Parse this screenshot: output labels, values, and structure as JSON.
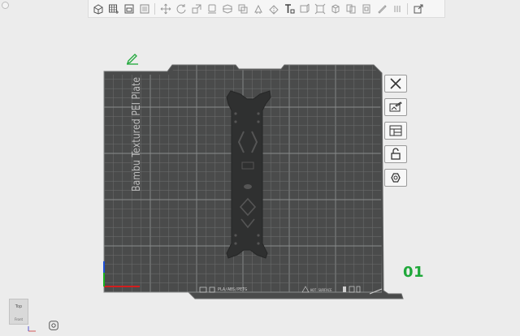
{
  "toolbar": {
    "buttons": [
      {
        "name": "add-object-icon"
      },
      {
        "name": "add-plate-icon"
      },
      {
        "name": "auto-orient-icon"
      },
      {
        "name": "arrange-icon"
      },
      {
        "name": "separator"
      },
      {
        "name": "move-icon"
      },
      {
        "name": "rotate-icon"
      },
      {
        "name": "scale-icon"
      },
      {
        "name": "lay-on-face-icon"
      },
      {
        "name": "cut-icon"
      },
      {
        "name": "mesh-boolean-icon"
      },
      {
        "name": "support-paint-icon"
      },
      {
        "name": "seam-paint-icon"
      },
      {
        "name": "text-icon"
      },
      {
        "name": "measure-icon"
      },
      {
        "name": "assembly-icon"
      },
      {
        "name": "explode-icon"
      },
      {
        "name": "split-to-objects-icon"
      },
      {
        "name": "split-to-parts-icon"
      },
      {
        "name": "layers-icon"
      },
      {
        "name": "variable-layer-icon"
      },
      {
        "name": "separator"
      },
      {
        "name": "settings-icon"
      }
    ]
  },
  "bed": {
    "vertical_label": "Bambu Textured PEI Plate",
    "footer_filament": "PLA/ABS/PETG",
    "footer_warning": "HOT SURFACE"
  },
  "plate": {
    "number": "01"
  },
  "side_tools": [
    {
      "name": "delete-plate-icon"
    },
    {
      "name": "plate-settings-icon"
    },
    {
      "name": "arrange-plate-icon"
    },
    {
      "name": "lock-plate-icon"
    },
    {
      "name": "slice-plate-icon"
    }
  ],
  "view_cube": {
    "top": "Top",
    "front": "Front"
  },
  "colors": {
    "bed": "#4a4b4b",
    "grid": "#7a7c7c",
    "part": "#2f3030",
    "accent": "#1fa83a"
  }
}
